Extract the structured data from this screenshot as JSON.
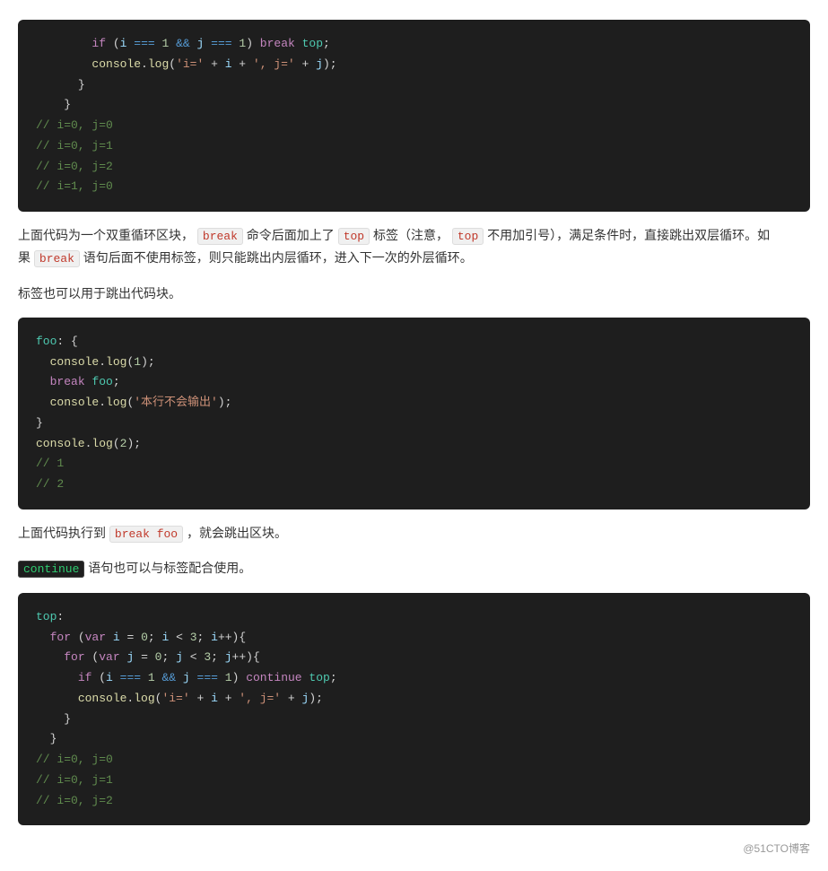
{
  "page": {
    "watermark": "@51CTO博客"
  },
  "code_block_1": {
    "lines": [
      "if_line",
      "console_line",
      "close_brace",
      "close_brace2",
      "comment1",
      "comment2",
      "comment3",
      "comment4"
    ]
  },
  "text_1": "上面代码为一个双重循环区块，break 命令后面加上了 top 标签（注意，top 不用加引号），满足条件时，直接跳出双层循环。如果 break 语句后面不使用标签，则只能跳出内层循环，进入下一次的外层循环。",
  "text_2": "标签也可以用于跳出代码块。",
  "code_block_2_lines": [
    "foo_label",
    "console_1",
    "break_foo",
    "console_2",
    "close_brace",
    "console_2_outer",
    "comment_1",
    "comment_2"
  ],
  "text_3_pre": "上面代码执行到",
  "text_3_code": "break foo",
  "text_3_post": "，就会跳出区块。",
  "text_4_pre": "continue",
  "text_4_post": " 语句也可以与标签配合使用。",
  "code_block_3_lines": [
    "top_label",
    "for_outer",
    "for_inner",
    "if_continue",
    "console_inner",
    "close_inner",
    "close_outer",
    "comment_1",
    "comment_2",
    "comment_3"
  ]
}
